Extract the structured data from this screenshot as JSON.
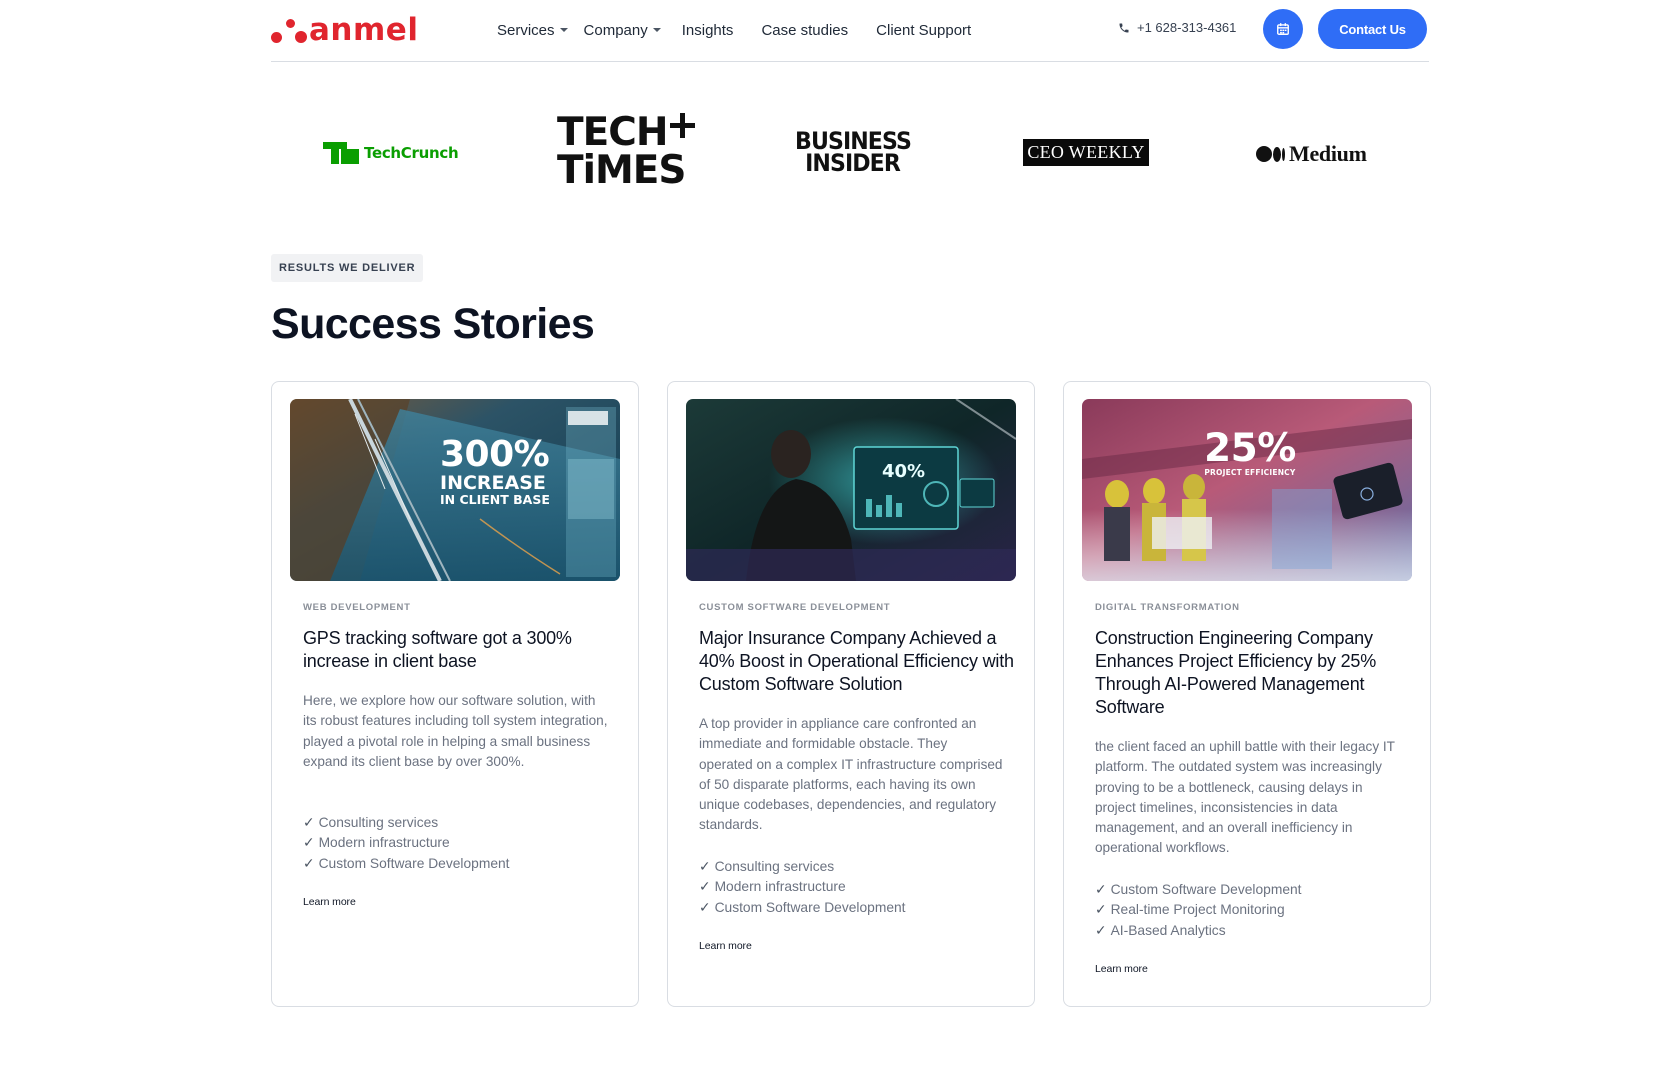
{
  "brand": {
    "name": "anmel",
    "color": "#e0252e"
  },
  "nav": {
    "items": [
      {
        "label": "Services",
        "dropdown": true
      },
      {
        "label": "Company",
        "dropdown": true
      },
      {
        "label": "Insights",
        "dropdown": false
      },
      {
        "label": "Case studies",
        "dropdown": false
      },
      {
        "label": "Client Support",
        "dropdown": false
      }
    ],
    "phone": "+1 628-313-4361",
    "calendar_icon": "calendar-icon",
    "contact_label": "Contact Us",
    "accent": "#2f6df6"
  },
  "press": {
    "techcrunch": "TechCrunch",
    "techtimes_line1": "TECH",
    "techtimes_line2": "TiMES",
    "bi_line1": "BUSINESS",
    "bi_line2": "INSIDER",
    "ceo": "CEO WEEKLY",
    "medium": "Medium"
  },
  "section": {
    "eyebrow": "RESULTS WE DELIVER",
    "title": "Success Stories"
  },
  "cards": [
    {
      "image_text": {
        "big": "300%",
        "line1": "INCREASE",
        "line2": "IN CLIENT BASE"
      },
      "category": "WEB DEVELOPMENT",
      "title": "GPS tracking software got a 300% increase in client base",
      "description": "Here, we explore how our software solution, with its robust features including toll system integration, played a pivotal role in helping a small business expand its client base by over 300%.",
      "features": [
        "Consulting services",
        "Modern infrastructure",
        "Custom Software Development"
      ],
      "link": "Learn more"
    },
    {
      "image_text": {
        "big": "40%"
      },
      "category": "CUSTOM SOFTWARE DEVELOPMENT",
      "title": "Major Insurance Company Achieved a 40% Boost in Operational Efficiency with Custom Software Solution",
      "description": "A top provider in appliance care confronted an immediate and formidable obstacle. They operated on a complex IT infrastructure comprised of 50 disparate platforms, each having its own unique codebases, dependencies, and regulatory standards.",
      "features": [
        "Consulting services",
        "Modern infrastructure",
        "Custom Software Development"
      ],
      "link": "Learn more"
    },
    {
      "image_text": {
        "big": "25%",
        "line1": "PROJECT EFFICIENCY"
      },
      "category": "DIGITAL TRANSFORMATION",
      "title": "Construction Engineering Company Enhances Project Efficiency by 25% Through AI-Powered Management Software",
      "description": "the client faced an uphill battle with their legacy IT platform. The outdated system was increasingly proving to be a bottleneck, causing delays in project timelines, inconsistencies in data management, and an overall inefficiency in operational workflows.",
      "features": [
        "Custom Software Development",
        "Real-time Project Monitoring",
        "AI-Based Analytics"
      ],
      "link": "Learn more"
    }
  ]
}
